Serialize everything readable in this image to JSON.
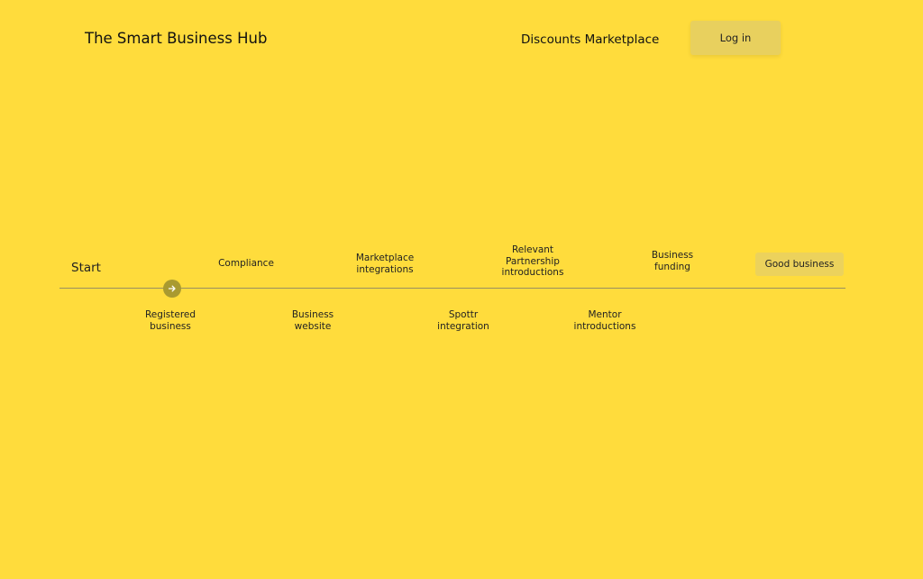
{
  "header": {
    "brand": "The Smart Business Hub",
    "nav_discounts": "Discounts Marketplace",
    "login_label": "Log in"
  },
  "timeline": {
    "start_label": "Start",
    "marker_icon": "arrow-right-icon",
    "steps_above": [
      "Compliance",
      "Marketplace\nintegrations",
      "Relevant\nPartnership\nintroductions",
      "Business\nfunding"
    ],
    "steps_below": [
      "Registered\nbusiness",
      "Business\nwebsite",
      "Spottr\nintegration",
      "Mentor\nintroductions"
    ],
    "goal": "Good business"
  },
  "colors": {
    "background": "#FFDC3C",
    "button_bg": "#E8D05E",
    "marker": "#A99A30",
    "line": "#9a9060"
  }
}
